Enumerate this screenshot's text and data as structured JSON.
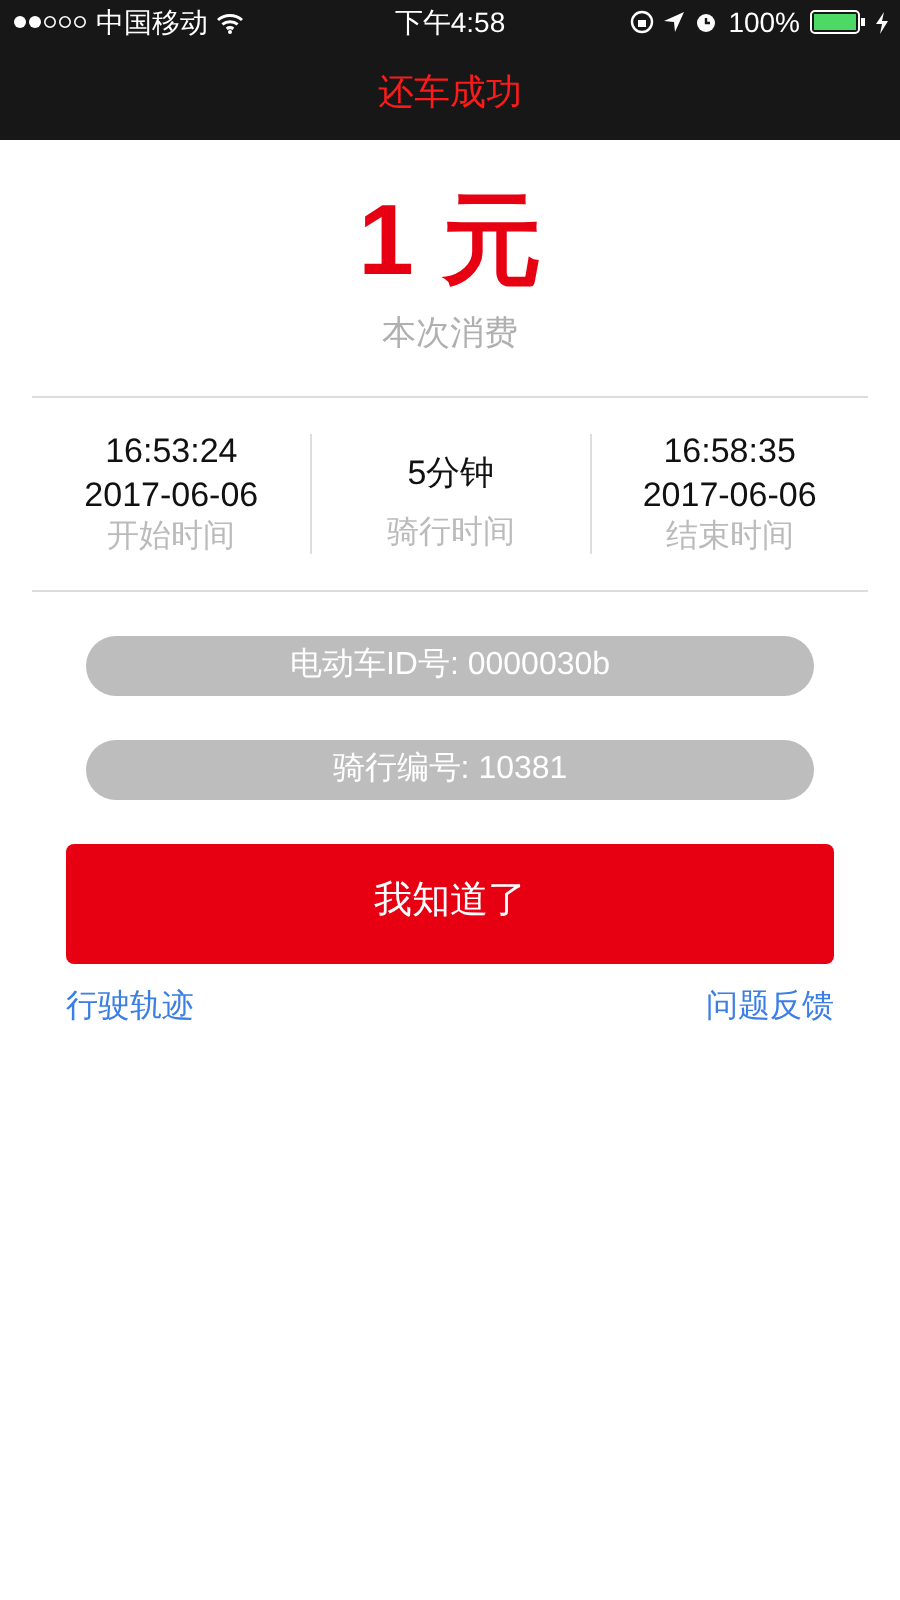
{
  "status_bar": {
    "carrier": "中国移动",
    "time": "下午4:58",
    "battery": "100%"
  },
  "nav_bar": {
    "title": "还车成功"
  },
  "cost": {
    "amount": "1 元",
    "label": "本次消费"
  },
  "stats": [
    {
      "lines": [
        "16:53:24",
        "2017-06-06"
      ],
      "label": "开始时间"
    },
    {
      "lines": [
        "5分钟"
      ],
      "label": "骑行时间"
    },
    {
      "lines": [
        "16:58:35",
        "2017-06-06"
      ],
      "label": "结束时间"
    }
  ],
  "info_pills": [
    "电动车ID号: 0000030b",
    "骑行编号: 10381"
  ],
  "confirm_button": "我知道了",
  "links": [
    "行驶轨迹",
    "问题反馈"
  ]
}
